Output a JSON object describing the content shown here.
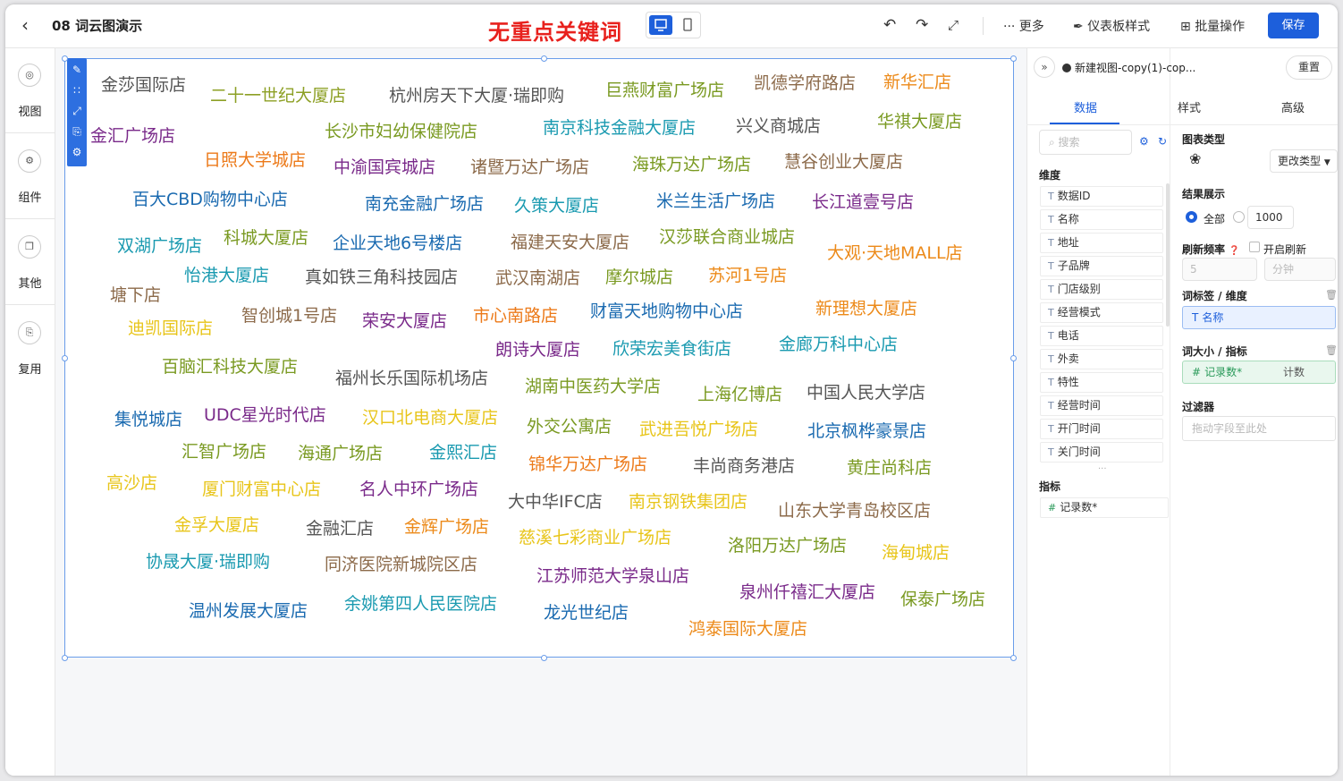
{
  "header": {
    "doc_title": "08 词云图演示",
    "center_title": "无重点关键词",
    "more": "··· 更多",
    "dashboard_style": "仪表板样式",
    "batch": "批量操作",
    "save": "保存"
  },
  "leftnav": [
    {
      "label": "视图",
      "icon": "view-icon"
    },
    {
      "label": "组件",
      "icon": "component-icon"
    },
    {
      "label": "其他",
      "icon": "other-icon"
    },
    {
      "label": "复用",
      "icon": "reuse-icon"
    }
  ],
  "wordcloud": [
    {
      "t": "金莎国际店",
      "c": "#555555"
    },
    {
      "t": "二十一世纪大厦店",
      "c": "#8da025"
    },
    {
      "t": "杭州房天下大厦·瑞即购",
      "c": "#555555"
    },
    {
      "t": "巨燕财富广场店",
      "c": "#7a9a22"
    },
    {
      "t": "凯德学府路店",
      "c": "#8c6a4a"
    },
    {
      "t": "新华汇店",
      "c": "#ec8a1a"
    },
    {
      "t": "金汇广场店",
      "c": "#7a2a8a"
    },
    {
      "t": "长沙市妇幼保健院店",
      "c": "#7a9a22"
    },
    {
      "t": "南京科技金融大厦店",
      "c": "#1a9ab0"
    },
    {
      "t": "兴义商城店",
      "c": "#555555"
    },
    {
      "t": "华祺大厦店",
      "c": "#7a9a22"
    },
    {
      "t": "日照大学城店",
      "c": "#ec7a1a"
    },
    {
      "t": "中渝国宾城店",
      "c": "#7a2a8a"
    },
    {
      "t": "诸暨万达广场店",
      "c": "#8c6a4a"
    },
    {
      "t": "海珠万达广场店",
      "c": "#7a9a22"
    },
    {
      "t": "慧谷创业大厦店",
      "c": "#8c6a4a"
    },
    {
      "t": "百大CBD购物中心店",
      "c": "#1a6ab0"
    },
    {
      "t": "南充金融广场店",
      "c": "#1a6ab0"
    },
    {
      "t": "久策大厦店",
      "c": "#1a9ab0"
    },
    {
      "t": "米兰生活广场店",
      "c": "#1a6ab0"
    },
    {
      "t": "长江道壹号店",
      "c": "#7a2a8a"
    },
    {
      "t": "双湖广场店",
      "c": "#1a9ab0"
    },
    {
      "t": "科城大厦店",
      "c": "#7a9a22"
    },
    {
      "t": "企业天地6号楼店",
      "c": "#1a6ab0"
    },
    {
      "t": "福建天安大厦店",
      "c": "#8c6a4a"
    },
    {
      "t": "汉莎联合商业城店",
      "c": "#7a9a22"
    },
    {
      "t": "大观·天地MALL店",
      "c": "#ec8a1a"
    },
    {
      "t": "怡港大厦店",
      "c": "#1a9ab0"
    },
    {
      "t": "真如铁三角科技园店",
      "c": "#555555"
    },
    {
      "t": "武汉南湖店",
      "c": "#8c6a4a"
    },
    {
      "t": "摩尔城店",
      "c": "#7a9a22"
    },
    {
      "t": "苏河1号店",
      "c": "#ec8a1a"
    },
    {
      "t": "塘下店",
      "c": "#8c6a4a"
    },
    {
      "t": "迪凯国际店",
      "c": "#e8c51a"
    },
    {
      "t": "智创城1号店",
      "c": "#8c6a4a"
    },
    {
      "t": "荣安大厦店",
      "c": "#7a2a8a"
    },
    {
      "t": "市心南路店",
      "c": "#ec7a1a"
    },
    {
      "t": "财富天地购物中心店",
      "c": "#1a6ab0"
    },
    {
      "t": "新理想大厦店",
      "c": "#ec8a1a"
    },
    {
      "t": "朗诗大厦店",
      "c": "#7a2a8a"
    },
    {
      "t": "欣荣宏美食街店",
      "c": "#1a9ab0"
    },
    {
      "t": "金廊万科中心店",
      "c": "#1a9ab0"
    },
    {
      "t": "百脑汇科技大厦店",
      "c": "#7a9a22"
    },
    {
      "t": "福州长乐国际机场店",
      "c": "#555555"
    },
    {
      "t": "湖南中医药大学店",
      "c": "#7a9a22"
    },
    {
      "t": "上海亿博店",
      "c": "#7a9a22"
    },
    {
      "t": "中国人民大学店",
      "c": "#555555"
    },
    {
      "t": "集悦城店",
      "c": "#1a6ab0"
    },
    {
      "t": "UDC星光时代店",
      "c": "#7a2a8a"
    },
    {
      "t": "汉口北电商大厦店",
      "c": "#e8c51a"
    },
    {
      "t": "外交公寓店",
      "c": "#7a9a22"
    },
    {
      "t": "武进吾悦广场店",
      "c": "#e8c51a"
    },
    {
      "t": "北京枫桦豪景店",
      "c": "#1a6ab0"
    },
    {
      "t": "汇智广场店",
      "c": "#7a9a22"
    },
    {
      "t": "海通广场店",
      "c": "#7a9a22"
    },
    {
      "t": "金熙汇店",
      "c": "#1a9ab0"
    },
    {
      "t": "锦华万达广场店",
      "c": "#ec7a1a"
    },
    {
      "t": "丰尚商务港店",
      "c": "#555555"
    },
    {
      "t": "黄庄尚科店",
      "c": "#7a9a22"
    },
    {
      "t": "高沙店",
      "c": "#e8c51a"
    },
    {
      "t": "厦门财富中心店",
      "c": "#e8c51a"
    },
    {
      "t": "名人中环广场店",
      "c": "#7a2a8a"
    },
    {
      "t": "大中华IFC店",
      "c": "#555555"
    },
    {
      "t": "南京钢铁集团店",
      "c": "#e8c51a"
    },
    {
      "t": "山东大学青岛校区店",
      "c": "#8c6a4a"
    },
    {
      "t": "金孚大厦店",
      "c": "#e8c51a"
    },
    {
      "t": "金融汇店",
      "c": "#555555"
    },
    {
      "t": "金辉广场店",
      "c": "#ec8a1a"
    },
    {
      "t": "慈溪七彩商业广场店",
      "c": "#e8c51a"
    },
    {
      "t": "洛阳万达广场店",
      "c": "#7a9a22"
    },
    {
      "t": "海甸城店",
      "c": "#e8c51a"
    },
    {
      "t": "协晟大厦·瑞即购",
      "c": "#1a9ab0"
    },
    {
      "t": "同济医院新城院区店",
      "c": "#8c6a4a"
    },
    {
      "t": "江苏师范大学泉山店",
      "c": "#7a2a8a"
    },
    {
      "t": "泉州仟禧汇大厦店",
      "c": "#7a2a8a"
    },
    {
      "t": "保泰广场店",
      "c": "#7a9a22"
    },
    {
      "t": "温州发展大厦店",
      "c": "#1a6ab0"
    },
    {
      "t": "余姚第四人民医院店",
      "c": "#1a9ab0"
    },
    {
      "t": "龙光世纪店",
      "c": "#1a6ab0"
    },
    {
      "t": "鸿泰国际大厦店",
      "c": "#ec8a1a"
    }
  ],
  "panel": {
    "view_name": "新建视图-copy(1)-cop...",
    "reset": "重置",
    "tabs": [
      "数据",
      "样式",
      "高级"
    ],
    "search_placeholder": "搜索",
    "dimension_label": "维度",
    "dimensions": [
      "数据ID",
      "名称",
      "地址",
      "子品牌",
      "门店级别",
      "经营模式",
      "电话",
      "外卖",
      "特性",
      "经营时间",
      "开门时间",
      "关门时间"
    ],
    "metric_label": "指标",
    "metrics": [
      "记录数*"
    ],
    "chart_type_label": "图表类型",
    "change_type": "更改类型",
    "result_label": "结果展示",
    "result_all": "全部",
    "result_count": "1000",
    "refresh_label": "刷新频率",
    "refresh_toggle": "开启刷新",
    "refresh_value": "5",
    "refresh_unit": "分钟",
    "tag_dim_label": "词标签 / 维度",
    "tag_dim_value": "名称",
    "size_metric_label": "词大小 / 指标",
    "size_metric_value": "记录数*",
    "size_metric_agg": "计数",
    "filter_label": "过滤器",
    "filter_placeholder": "拖动字段至此处"
  }
}
